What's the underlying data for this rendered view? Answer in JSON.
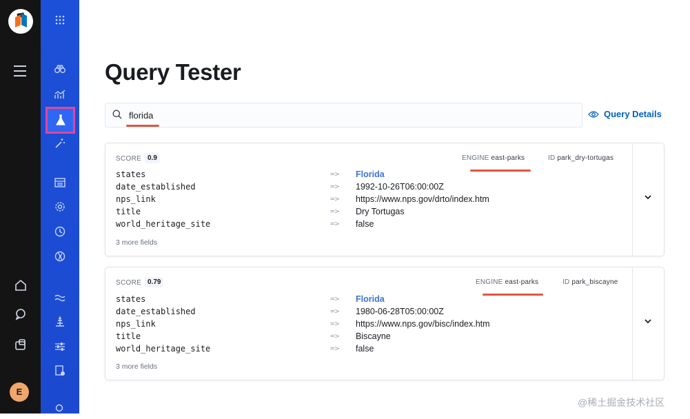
{
  "page": {
    "title": "Query Tester"
  },
  "search": {
    "value": "florida",
    "placeholder": ""
  },
  "query_details": {
    "label": "Query Details"
  },
  "user": {
    "initial": "E"
  },
  "results": [
    {
      "score_label": "SCORE",
      "score": "0.9",
      "engine_label": "ENGINE",
      "engine": "east-parks",
      "id_label": "ID",
      "id": "park_dry-tortugas",
      "fields": [
        {
          "key": "states",
          "arrow": "=>",
          "value": "Florida"
        },
        {
          "key": "date_established",
          "arrow": "=>",
          "value": "1992-10-26T06:00:00Z"
        },
        {
          "key": "nps_link",
          "arrow": "=>",
          "value": "https://www.nps.gov/drto/index.htm"
        },
        {
          "key": "title",
          "arrow": "=>",
          "value": "Dry Tortugas"
        },
        {
          "key": "world_heritage_site",
          "arrow": "=>",
          "value": "false"
        }
      ],
      "more_fields": "3 more fields"
    },
    {
      "score_label": "SCORE",
      "score": "0.79",
      "engine_label": "ENGINE",
      "engine": "east-parks",
      "id_label": "ID",
      "id": "park_biscayne",
      "fields": [
        {
          "key": "states",
          "arrow": "=>",
          "value": "Florida"
        },
        {
          "key": "date_established",
          "arrow": "=>",
          "value": "1980-06-28T05:00:00Z"
        },
        {
          "key": "nps_link",
          "arrow": "=>",
          "value": "https://www.nps.gov/bisc/index.htm"
        },
        {
          "key": "title",
          "arrow": "=>",
          "value": "Biscayne"
        },
        {
          "key": "world_heritage_site",
          "arrow": "=>",
          "value": "false"
        }
      ],
      "more_fields": "3 more fields"
    }
  ],
  "watermark": "@稀土掘金技术社区",
  "colors": {
    "rail_bg": "#141414",
    "side_bg": "#1d50d8",
    "accent_link": "#0061c2",
    "highlight_box": "#e0479b",
    "annotation_red": "#e0553f"
  },
  "icons": {
    "rail": [
      "hamburger-icon",
      "home-icon",
      "chat-icon",
      "apps-icon"
    ],
    "side": [
      "grid-icon",
      "binoculars-icon",
      "analytics-icon",
      "flask-icon",
      "magic-wand-icon",
      "documents-icon",
      "gear-icon",
      "clock-icon",
      "globe-icon",
      "wave-icon",
      "boost-icon",
      "sliders-icon",
      "doc-settings-icon",
      "search-icon"
    ]
  }
}
